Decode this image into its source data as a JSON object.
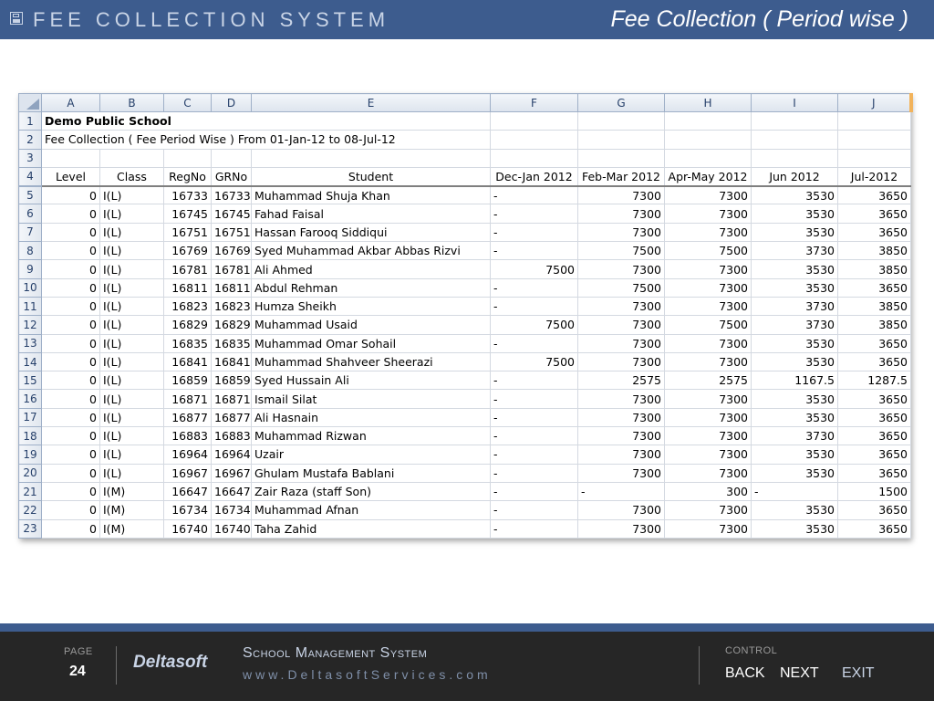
{
  "header": {
    "app_title": "FEE COLLECTION SYSTEM",
    "page_heading": "Fee Collection ( Period wise )"
  },
  "spreadsheet": {
    "columns": [
      "A",
      "B",
      "C",
      "D",
      "E",
      "F",
      "G",
      "H",
      "I",
      "J"
    ],
    "title_row": {
      "row": "1",
      "text": "Demo Public School"
    },
    "subtitle_row": {
      "row": "2",
      "text": "Fee Collection ( Fee Period Wise ) From 01-Jan-12 to 08-Jul-12"
    },
    "blank_row": {
      "row": "3"
    },
    "header_row": {
      "row": "4",
      "cells": [
        "Level",
        "Class",
        "RegNo",
        "GRNo",
        "Student",
        "Dec-Jan 2012",
        "Feb-Mar 2012",
        "Apr-May 2012",
        "Jun 2012",
        "Jul-2012"
      ]
    },
    "rows": [
      {
        "row": "5",
        "level": "0",
        "class": "I(L)",
        "regno": "16733",
        "grno": "16733",
        "student": "Muhammad Shuja Khan",
        "dec_jan": "-",
        "feb_mar": "7300",
        "apr_may": "7300",
        "jun": "3530",
        "jul": "3650"
      },
      {
        "row": "6",
        "level": "0",
        "class": "I(L)",
        "regno": "16745",
        "grno": "16745",
        "student": "Fahad Faisal",
        "dec_jan": "-",
        "feb_mar": "7300",
        "apr_may": "7300",
        "jun": "3530",
        "jul": "3650"
      },
      {
        "row": "7",
        "level": "0",
        "class": "I(L)",
        "regno": "16751",
        "grno": "16751",
        "student": "Hassan Farooq Siddiqui",
        "dec_jan": "-",
        "feb_mar": "7300",
        "apr_may": "7300",
        "jun": "3530",
        "jul": "3650"
      },
      {
        "row": "8",
        "level": "0",
        "class": "I(L)",
        "regno": "16769",
        "grno": "16769",
        "student": "Syed Muhammad Akbar Abbas Rizvi",
        "dec_jan": "-",
        "feb_mar": "7500",
        "apr_may": "7500",
        "jun": "3730",
        "jul": "3850"
      },
      {
        "row": "9",
        "level": "0",
        "class": "I(L)",
        "regno": "16781",
        "grno": "16781",
        "student": "Ali Ahmed",
        "dec_jan": "7500",
        "feb_mar": "7300",
        "apr_may": "7300",
        "jun": "3530",
        "jul": "3850"
      },
      {
        "row": "10",
        "level": "0",
        "class": "I(L)",
        "regno": "16811",
        "grno": "16811",
        "student": "Abdul Rehman",
        "dec_jan": "-",
        "feb_mar": "7500",
        "apr_may": "7300",
        "jun": "3530",
        "jul": "3650"
      },
      {
        "row": "11",
        "level": "0",
        "class": "I(L)",
        "regno": "16823",
        "grno": "16823",
        "student": "Humza Sheikh",
        "dec_jan": "-",
        "feb_mar": "7300",
        "apr_may": "7300",
        "jun": "3730",
        "jul": "3850"
      },
      {
        "row": "12",
        "level": "0",
        "class": "I(L)",
        "regno": "16829",
        "grno": "16829",
        "student": "Muhammad Usaid",
        "dec_jan": "7500",
        "feb_mar": "7300",
        "apr_may": "7500",
        "jun": "3730",
        "jul": "3850"
      },
      {
        "row": "13",
        "level": "0",
        "class": "I(L)",
        "regno": "16835",
        "grno": "16835",
        "student": "Muhammad Omar Sohail",
        "dec_jan": "-",
        "feb_mar": "7300",
        "apr_may": "7300",
        "jun": "3530",
        "jul": "3650"
      },
      {
        "row": "14",
        "level": "0",
        "class": "I(L)",
        "regno": "16841",
        "grno": "16841",
        "student": "Muhammad Shahveer Sheerazi",
        "dec_jan": "7500",
        "feb_mar": "7300",
        "apr_may": "7300",
        "jun": "3530",
        "jul": "3650"
      },
      {
        "row": "15",
        "level": "0",
        "class": "I(L)",
        "regno": "16859",
        "grno": "16859",
        "student": "Syed Hussain Ali",
        "dec_jan": "-",
        "feb_mar": "2575",
        "apr_may": "2575",
        "jun": "1167.5",
        "jul": "1287.5"
      },
      {
        "row": "16",
        "level": "0",
        "class": "I(L)",
        "regno": "16871",
        "grno": "16871",
        "student": "Ismail Silat",
        "dec_jan": "-",
        "feb_mar": "7300",
        "apr_may": "7300",
        "jun": "3530",
        "jul": "3650"
      },
      {
        "row": "17",
        "level": "0",
        "class": "I(L)",
        "regno": "16877",
        "grno": "16877",
        "student": "Ali Hasnain",
        "dec_jan": "-",
        "feb_mar": "7300",
        "apr_may": "7300",
        "jun": "3530",
        "jul": "3650"
      },
      {
        "row": "18",
        "level": "0",
        "class": "I(L)",
        "regno": "16883",
        "grno": "16883",
        "student": "Muhammad Rizwan",
        "dec_jan": "-",
        "feb_mar": "7300",
        "apr_may": "7300",
        "jun": "3730",
        "jul": "3650"
      },
      {
        "row": "19",
        "level": "0",
        "class": "I(L)",
        "regno": "16964",
        "grno": "16964",
        "student": "Uzair",
        "dec_jan": "-",
        "feb_mar": "7300",
        "apr_may": "7300",
        "jun": "3530",
        "jul": "3650"
      },
      {
        "row": "20",
        "level": "0",
        "class": "I(L)",
        "regno": "16967",
        "grno": "16967",
        "student": "Ghulam Mustafa Bablani",
        "dec_jan": "-",
        "feb_mar": "7300",
        "apr_may": "7300",
        "jun": "3530",
        "jul": "3650"
      },
      {
        "row": "21",
        "level": "0",
        "class": "I(M)",
        "regno": "16647",
        "grno": "16647",
        "student": "Zair Raza (staff Son)",
        "dec_jan": "-",
        "feb_mar": "-",
        "apr_may": "300",
        "jun": "-",
        "jul": "1500"
      },
      {
        "row": "22",
        "level": "0",
        "class": "I(M)",
        "regno": "16734",
        "grno": "16734",
        "student": "Muhammad Afnan",
        "dec_jan": "-",
        "feb_mar": "7300",
        "apr_may": "7300",
        "jun": "3530",
        "jul": "3650"
      },
      {
        "row": "23",
        "level": "0",
        "class": "I(M)",
        "regno": "16740",
        "grno": "16740",
        "student": "Taha Zahid",
        "dec_jan": "-",
        "feb_mar": "7300",
        "apr_may": "7300",
        "jun": "3530",
        "jul": "3650"
      }
    ]
  },
  "footer": {
    "page_label": "PAGE",
    "page_number": "24",
    "brand": "Deltasoft",
    "system_name": "School Management System",
    "website": "www.DeltasoftServices.com",
    "control_label": "CONTROL",
    "back_label": "BACK",
    "next_label": "NEXT",
    "exit_label": "EXIT"
  }
}
